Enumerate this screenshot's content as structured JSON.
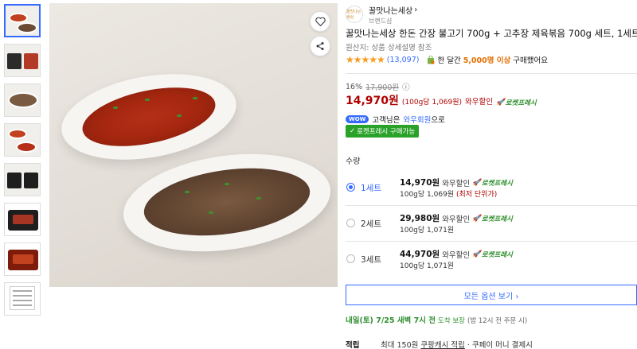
{
  "thumbnails": [
    {
      "kind": "two-dishes",
      "active": true
    },
    {
      "kind": "trays"
    },
    {
      "kind": "close-up"
    },
    {
      "kind": "two-dishes"
    },
    {
      "kind": "trays-dark"
    },
    {
      "kind": "package"
    },
    {
      "kind": "tray-red"
    },
    {
      "kind": "label-document"
    }
  ],
  "product": {
    "brand_logo_text": "꿀맛나는세상",
    "brand_name": "꿀맛나는세상",
    "brand_sub": "브랜드샵",
    "title": "꿀맛나는세상 한돈 간장 불고기 700g + 고추장 제육볶음 700g 세트, 1세트",
    "origin": "원산지: 상품 상세설명 참조",
    "stars": "★★★★★",
    "review_count": "(13,097)",
    "bought_prefix": "한 달간",
    "bought_highlight": "5,000명 이상",
    "bought_suffix": "구매했어요"
  },
  "pricing": {
    "discount": "16%",
    "original_price": "17,900원",
    "info_icon": "ⓘ",
    "price": "14,970원",
    "unit_price": "(100g당 1,069원)",
    "wow_label": "와우할인",
    "rocket_label": "로켓프레시"
  },
  "wow": {
    "badge": "WOW",
    "text_prefix": "고객님은",
    "link": "와우회원",
    "text_suffix": "으로",
    "rocket_buy": "로켓프레시 구매가능"
  },
  "quantity": {
    "label": "수량",
    "options": [
      {
        "name": "1세트",
        "price": "14,970원",
        "wow": "와우할인",
        "rocket": "로켓프레시",
        "unit": "100g당 1,069원",
        "lowest": "(최저 단위가)",
        "selected": true
      },
      {
        "name": "2세트",
        "price": "29,980원",
        "wow": "와우할인",
        "rocket": "로켓프레시",
        "unit": "100g당 1,071원",
        "lowest": "",
        "selected": false
      },
      {
        "name": "3세트",
        "price": "44,970원",
        "wow": "와우할인",
        "rocket": "로켓프레시",
        "unit": "100g당 1,071원",
        "lowest": "",
        "selected": false
      }
    ],
    "all_options": "모든 옵션 보기 ›"
  },
  "delivery": {
    "main": "내일(토) 7/25 새벽 7시 전",
    "sub": "도착 보장",
    "note": "(밤 12시 전 주문 시)"
  },
  "points": {
    "label": "적립",
    "prefix": "최대 150원",
    "link": "쿠팡캐시 적립",
    "suffix": "· 쿠페이 머니 결제시"
  },
  "colors": {
    "accent": "#346aff",
    "price": "#ae0000",
    "rocket": "#2f8f2e",
    "star": "#f59b1d"
  }
}
